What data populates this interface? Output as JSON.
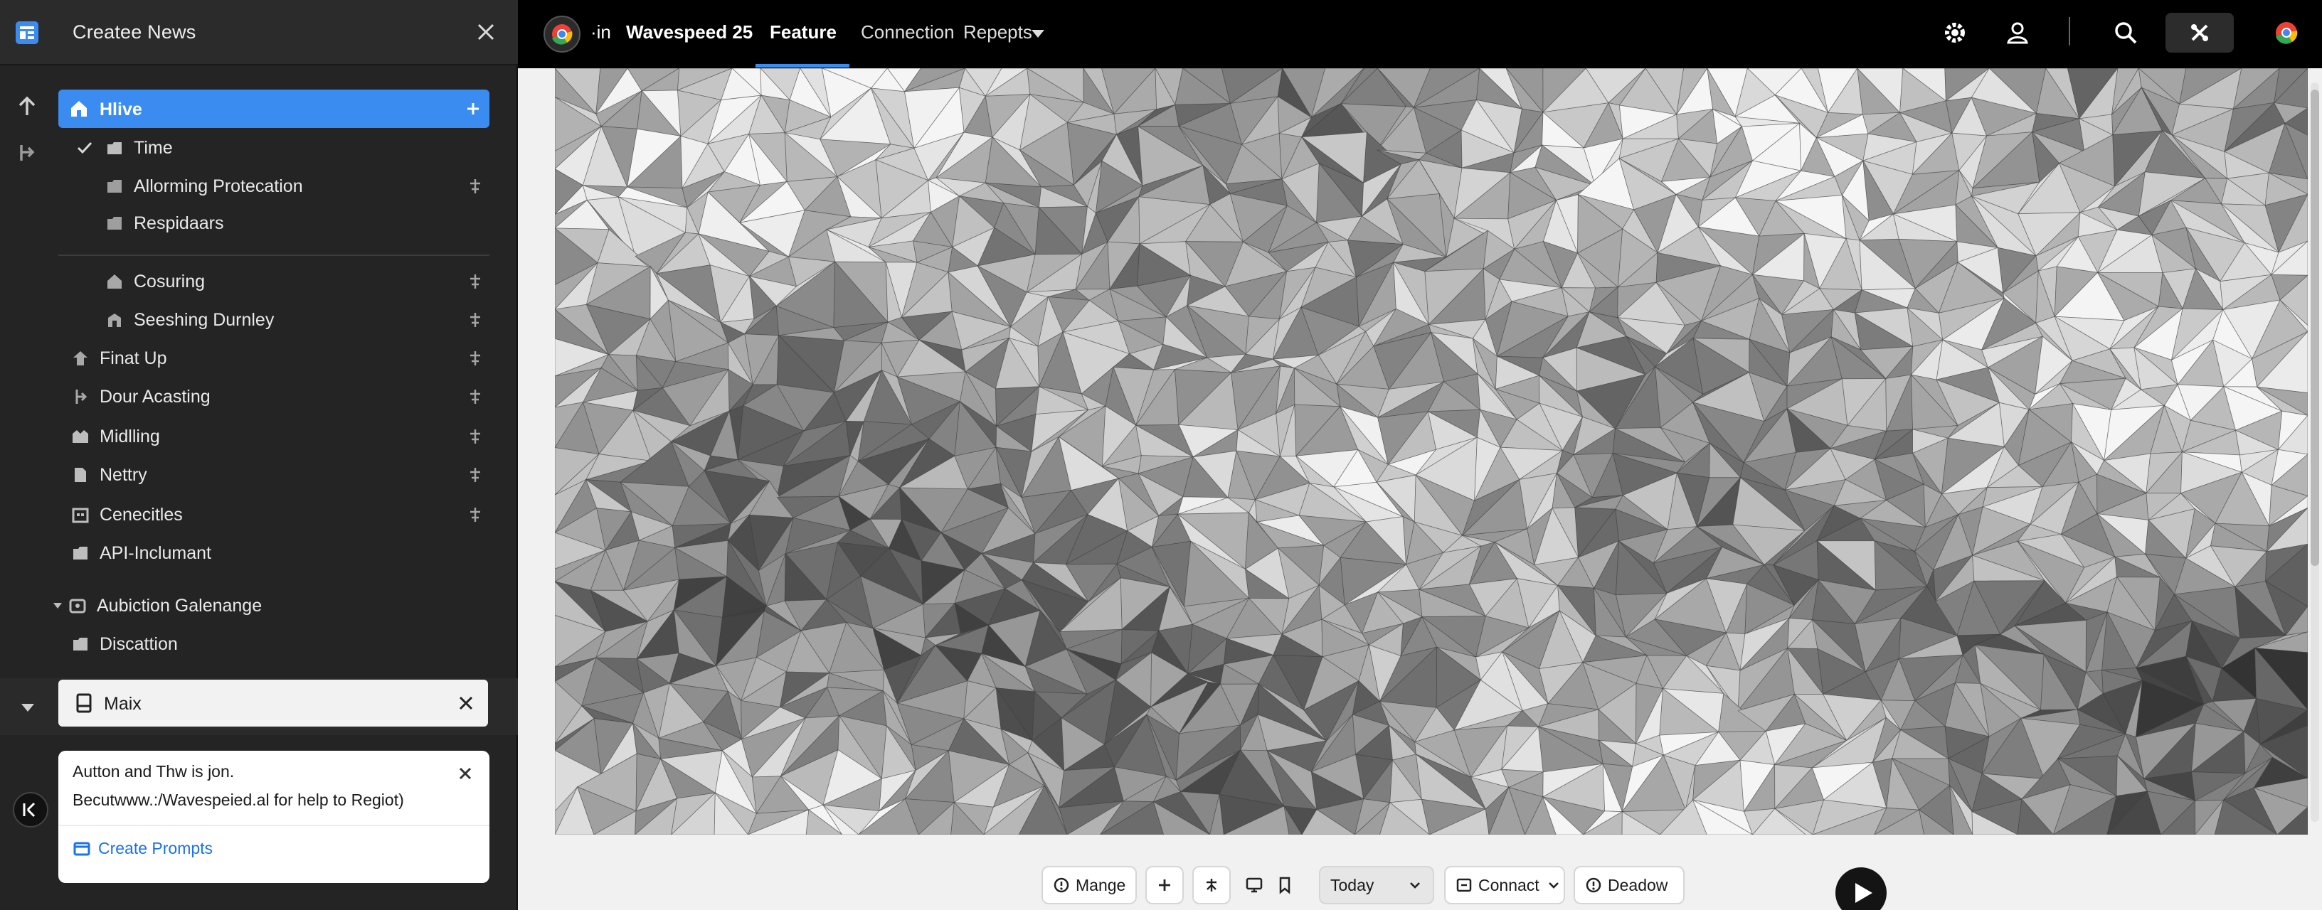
{
  "sidebar": {
    "title": "Createe News",
    "active_item": "Hlive",
    "items": [
      {
        "label": "Time"
      },
      {
        "label": "Allorming Protecation"
      },
      {
        "label": "Respidaars"
      },
      {
        "label": "Cosuring"
      },
      {
        "label": "Seeshing Durnley"
      },
      {
        "label": "Finat Up"
      },
      {
        "label": "Dour Acasting"
      },
      {
        "label": "Midlling"
      },
      {
        "label": "Nettry"
      },
      {
        "label": "Cenecitles"
      },
      {
        "label": "API-Inclumant"
      },
      {
        "label": "Aubiction Galenange"
      },
      {
        "label": "Discattion"
      }
    ],
    "maix_label": "Maix"
  },
  "toast": {
    "line1": "Autton and Thw is jon.",
    "line2": "Becutwww.:/Wavespeied.al for help to Regiot)",
    "link": "Create Prompts"
  },
  "topbar": {
    "prefix": "·in",
    "title": "Wavespeed 25",
    "tabs": [
      "Feature",
      "Connection",
      "Repepts"
    ],
    "active_tab": "Feature"
  },
  "toolbar": {
    "mange": "Mange",
    "today": "Today",
    "connact": "Connact",
    "deadow": "Deadow"
  },
  "colors": {
    "accent": "#3a8cf0",
    "sidebar_bg": "#242424",
    "topbar_bg": "#000000"
  },
  "icons": [
    "app-logo-icon",
    "close-icon",
    "arrow-up-icon",
    "branch-icon",
    "home-icon",
    "plus-icon",
    "check-icon",
    "folder-icon",
    "pin-icon",
    "gear-icon",
    "user-icon",
    "search-icon",
    "tools-icon",
    "chrome-icon",
    "play-icon",
    "info-icon",
    "monitor-icon",
    "chevron-down-icon"
  ]
}
